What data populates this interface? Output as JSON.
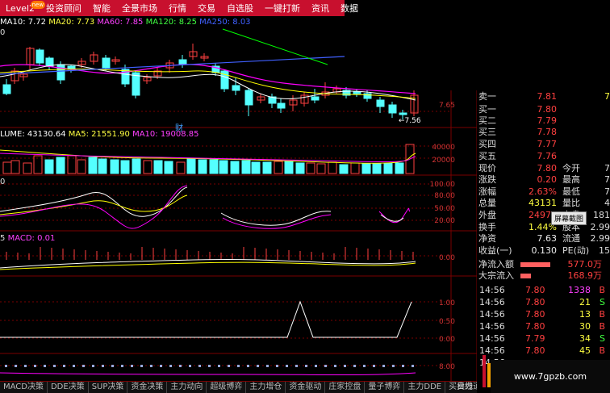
{
  "menu": [
    {
      "label": "Level2",
      "badge": "new"
    },
    {
      "label": "投资顾问"
    },
    {
      "label": "智能"
    },
    {
      "label": "全景市场"
    },
    {
      "label": "行情"
    },
    {
      "label": "交易"
    },
    {
      "label": "自选股"
    },
    {
      "label": "一键打新"
    },
    {
      "label": "资讯"
    },
    {
      "label": "数据"
    }
  ],
  "ma_header": {
    "ma10": "MA10: 7.72",
    "ma20": "MA20: 7.73",
    "ma60": "MA60: 7.85",
    "ma120": "MA120: 8.25",
    "ma250": "MA250: 8.03",
    "row2": "0"
  },
  "price_axis": {
    "p1": "7.65"
  },
  "price_annotation": "←7.56",
  "cai_marker": "财",
  "volume_header": {
    "volume": "LUME: 43130.64",
    "ma5": "MA5: 21551.90",
    "ma10": "MA10: 19008.85"
  },
  "volume_axis": {
    "v1": "40000",
    "v2": "20000"
  },
  "kdj_axis": {
    "a1": "100.00",
    "a2": "80.00",
    "a3": "50.00",
    "a4": "20.00"
  },
  "kdj_label": "0",
  "macd_header": {
    "prefix": "5",
    "label": "MACD: 0.01"
  },
  "macd_axis": {
    "a1": "0.00"
  },
  "panel5_axis": {
    "a1": "1.00",
    "a2": "0.50",
    "a3": "0.00"
  },
  "panel6_axis": {
    "a1": "8.00"
  },
  "quote": {
    "ask1": {
      "label": "卖一",
      "price": "7.81",
      "vol": "7"
    },
    "bid1": {
      "label": "买一",
      "price": "7.80"
    },
    "bid2": {
      "label": "买二",
      "price": "7.79"
    },
    "bid3": {
      "label": "买三",
      "price": "7.78"
    },
    "bid4": {
      "label": "买四",
      "price": "7.77"
    },
    "bid5": {
      "label": "买五",
      "price": "7.76"
    },
    "now": {
      "label": "现价",
      "val": "7.80",
      "label2": "今开",
      "val2": "7"
    },
    "chg": {
      "label": "涨跌",
      "val": "0.20",
      "label2": "最高",
      "val2": "7"
    },
    "pct": {
      "label": "涨幅",
      "val": "2.63%",
      "label2": "最低",
      "val2": "7"
    },
    "vol": {
      "label": "总量",
      "val": "43131",
      "label2": "量比",
      "val2": "4"
    },
    "outer": {
      "label": "外盘",
      "val": "24975",
      "label2": "内盘",
      "val2": "181"
    },
    "turnover": {
      "label": "换手",
      "val": "1.44%",
      "label2": "股本",
      "val2": "2.99"
    },
    "nav": {
      "label": "净资",
      "val": "7.63",
      "label2": "流通",
      "val2": "2.99"
    },
    "eps": {
      "label": "收益(一)",
      "val": "0.130",
      "label2": "PE(动)",
      "val2": "15"
    },
    "netflow": {
      "label": "净流入额",
      "val": "577.0万",
      "bar": 0.62
    },
    "block": {
      "label": "大宗流入",
      "val": "168.9万",
      "bar": 0.22
    }
  },
  "tooltip": "屏幕截图",
  "ticks": [
    {
      "time": "14:56",
      "price": "7.80",
      "vol": "1338",
      "bs": "B",
      "vol_color": "#ff40ff"
    },
    {
      "time": "14:56",
      "price": "7.80",
      "vol": "21",
      "bs": "S",
      "vol_color": "#ffff40"
    },
    {
      "time": "14:56",
      "price": "7.80",
      "vol": "13",
      "bs": "B",
      "vol_color": "#ffff40"
    },
    {
      "time": "14:56",
      "price": "7.80",
      "vol": "30",
      "bs": "B",
      "vol_color": "#ffff40"
    },
    {
      "time": "14:56",
      "price": "7.79",
      "vol": "34",
      "bs": "S",
      "vol_color": "#ffff40"
    },
    {
      "time": "14:56",
      "price": "7.80",
      "vol": "45",
      "bs": "B",
      "vol_color": "#ffff40"
    },
    {
      "time": "14:56",
      "price": "",
      "vol": "",
      "bs": "",
      "vol_color": "#ffff40"
    }
  ],
  "tabs": [
    "MACD决策",
    "DDE决策",
    "SUP决策",
    "资金决策",
    "主力动向",
    "超级博弈",
    "主力增仓",
    "资金驱动",
    "庄家控盘",
    "量子博弈",
    "主力DDE",
    "买卖力道",
    "资金 (▾)"
  ],
  "period": "日线",
  "watermark": "www.7gpzb.com",
  "colors": {
    "menu_bg": "#c8102e",
    "grid": "#7a0000",
    "up": "#ff4040",
    "down": "#54ffff",
    "ma10": "#ffffff",
    "ma20": "#ffff00",
    "ma60": "#ff00ff",
    "ma120": "#00ff00",
    "ma250": "#4060ff"
  }
}
